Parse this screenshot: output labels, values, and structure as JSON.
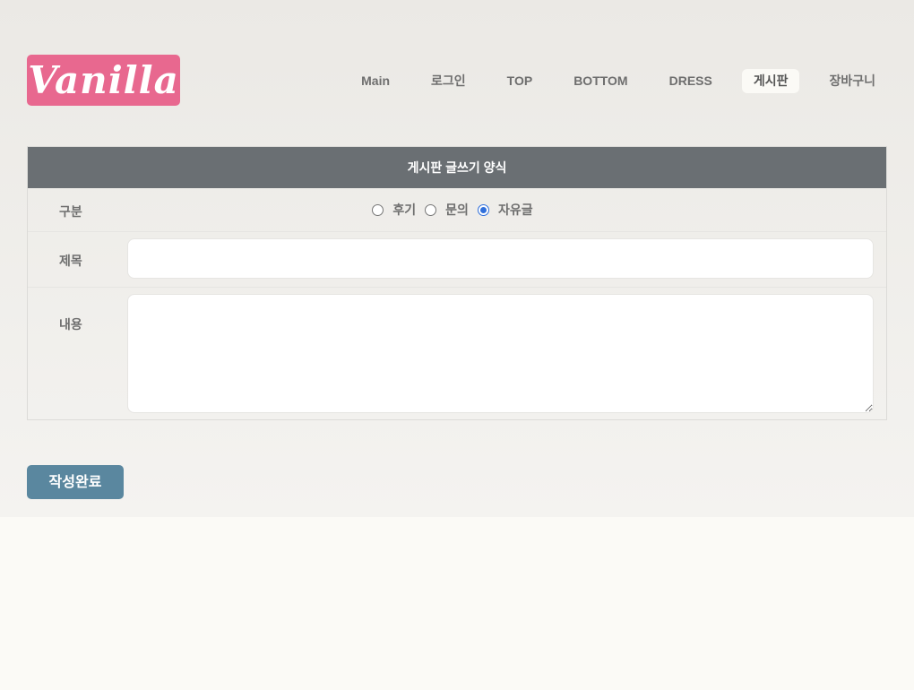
{
  "header": {
    "logo_text": "Vanilla",
    "nav": [
      {
        "label": "Main",
        "active": false
      },
      {
        "label": "로그인",
        "active": false
      },
      {
        "label": "TOP",
        "active": false
      },
      {
        "label": "BOTTOM",
        "active": false
      },
      {
        "label": "DRESS",
        "active": false
      },
      {
        "label": "게시판",
        "active": true
      },
      {
        "label": "장바구니",
        "active": false
      }
    ]
  },
  "form": {
    "title": "게시판 글쓰기 양식",
    "category": {
      "label": "구분",
      "options": [
        {
          "label": "후기",
          "checked": false
        },
        {
          "label": "문의",
          "checked": false
        },
        {
          "label": "자유글",
          "checked": true
        }
      ]
    },
    "subject": {
      "label": "제목",
      "value": "",
      "placeholder": ""
    },
    "content": {
      "label": "내용",
      "value": "",
      "placeholder": ""
    },
    "submit_label": "작성완료"
  },
  "colors": {
    "logo_bg": "#e8688f",
    "form_header_bg": "#6a6f73",
    "submit_bg": "#5a879f",
    "radio_checked": "#2f6fdb"
  }
}
